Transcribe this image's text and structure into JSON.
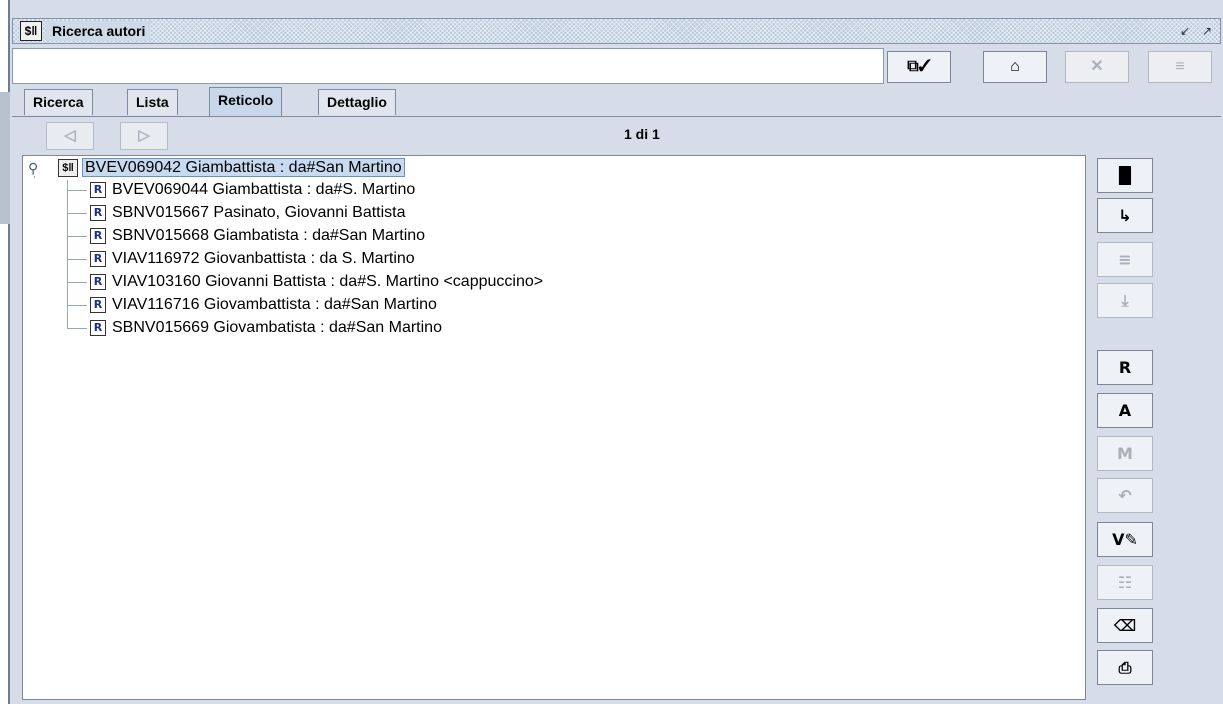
{
  "window": {
    "title": "Ricerca autori",
    "icon_label": "$‖"
  },
  "toolbar": {
    "buttons": [
      {
        "name": "transfer-icon",
        "glyph": "⧉✓",
        "enabled": true
      },
      {
        "name": "home-icon",
        "glyph": "⌂",
        "enabled": true
      },
      {
        "name": "close-x-icon",
        "glyph": "✕",
        "enabled": false
      },
      {
        "name": "list-icon",
        "glyph": "≡",
        "enabled": false
      }
    ]
  },
  "tabs": [
    {
      "label": "Ricerca",
      "active": false
    },
    {
      "label": "Lista",
      "active": false
    },
    {
      "label": "Reticolo",
      "active": true
    },
    {
      "label": "Dettaglio",
      "active": false
    }
  ],
  "navigation": {
    "prev_glyph": "◁",
    "next_glyph": "▷",
    "counter": "1 di 1"
  },
  "tree": {
    "root": {
      "icon": "$‖",
      "text": "BVEV069042 Giambattista : da#San Martino",
      "selected": true
    },
    "children": [
      {
        "icon": "R",
        "text": "BVEV069044 Giambattista : da#S. Martino"
      },
      {
        "icon": "R",
        "text": "SBNV015667 Pasinato, Giovanni Battista"
      },
      {
        "icon": "R",
        "text": "SBNV015668 Giambatista : da#San Martino"
      },
      {
        "icon": "R",
        "text": "VIAV116972 Giovanbattista : da S. Martino"
      },
      {
        "icon": "R",
        "text": "VIAV103160 Giovanni Battista : da#S. Martino <cappuccino>"
      },
      {
        "icon": "R",
        "text": "VIAV116716 Giovambattista : da#San Martino"
      },
      {
        "icon": "R",
        "text": "SBNV015669 Giovambatista : da#San Martino"
      }
    ]
  },
  "side_toolbar": [
    {
      "name": "books-icon",
      "glyph": "▐▌",
      "enabled": true
    },
    {
      "name": "tree-link-icon",
      "glyph": "↳",
      "enabled": true
    },
    {
      "name": "document-icon",
      "glyph": "≡",
      "enabled": false
    },
    {
      "name": "download-icon",
      "glyph": "⤓",
      "enabled": false
    },
    {
      "name": "r-icon",
      "glyph": "R",
      "enabled": true
    },
    {
      "name": "a-icon",
      "glyph": "A",
      "enabled": true
    },
    {
      "name": "m-icon",
      "glyph": "M",
      "enabled": false
    },
    {
      "name": "undo-icon",
      "glyph": "↶",
      "enabled": false
    },
    {
      "name": "check-edit-icon",
      "glyph": "V✎",
      "enabled": true
    },
    {
      "name": "form-icon",
      "glyph": "☷",
      "enabled": false
    },
    {
      "name": "eraser-icon",
      "glyph": "⌫",
      "enabled": true
    },
    {
      "name": "print-icon",
      "glyph": "⎙",
      "enabled": true
    }
  ]
}
